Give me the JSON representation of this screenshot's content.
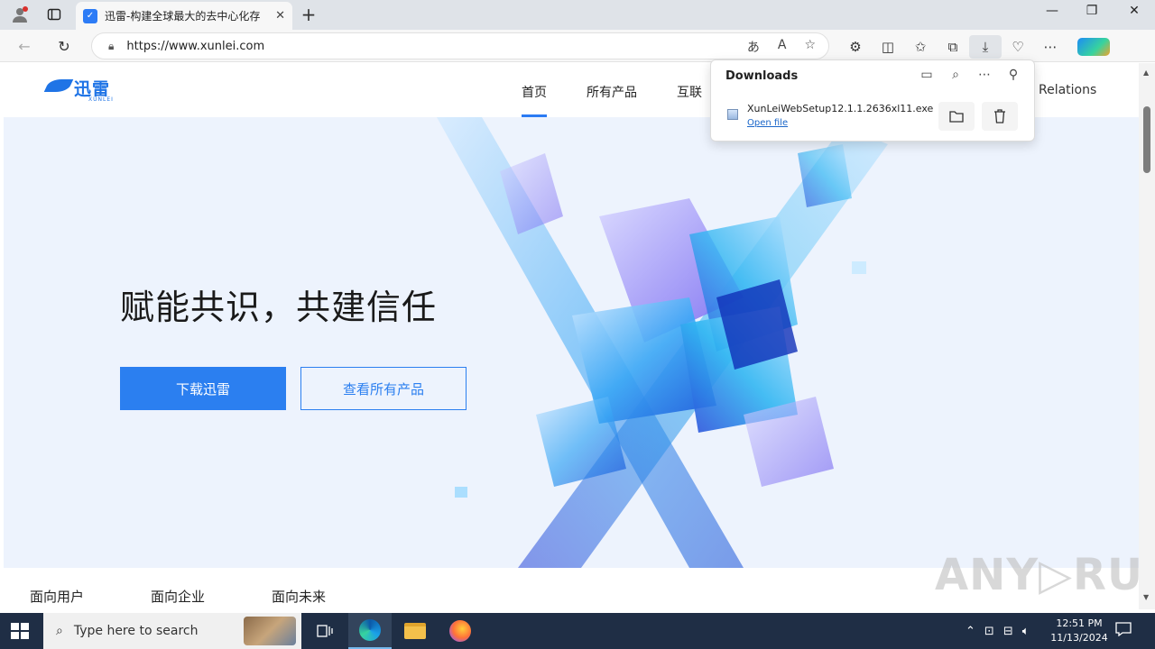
{
  "browser": {
    "tab_title": "迅雷-构建全球最大的去中心化存",
    "url": "https://www.xunlei.com",
    "icons": [
      "profile-icon",
      "tab-actions-icon",
      "close-icon",
      "new-tab-icon",
      "back-icon",
      "refresh-icon",
      "lock-icon",
      "translate-icon",
      "read-aloud-icon",
      "favorite-star-icon",
      "extensions-icon",
      "split-screen-icon",
      "favorites-icon",
      "collections-icon",
      "downloads-icon",
      "browser-essentials-icon",
      "more-icon",
      "copilot-icon"
    ],
    "window_controls": {
      "minimize": "—",
      "maximize": "❐",
      "close": "✕"
    }
  },
  "downloads": {
    "title": "Downloads",
    "file_name": "XunLeiWebSetup12.1.1.2636xl11.exe",
    "open_file": "Open file"
  },
  "site": {
    "logo_text": "迅雷",
    "logo_sub": "XUNLEI",
    "nav": [
      "首页",
      "所有产品",
      "互联"
    ],
    "nav_relations": "Relations",
    "hero_title": "赋能共识，共建信任",
    "btn_download": "下载迅雷",
    "btn_products": "查看所有产品",
    "subnav": [
      "面向用户",
      "面向企业",
      "面向未来"
    ]
  },
  "watermark": "ANY▷RUN",
  "taskbar": {
    "search_placeholder": "Type here to search",
    "time": "12:51 PM",
    "date": "11/13/2024"
  }
}
